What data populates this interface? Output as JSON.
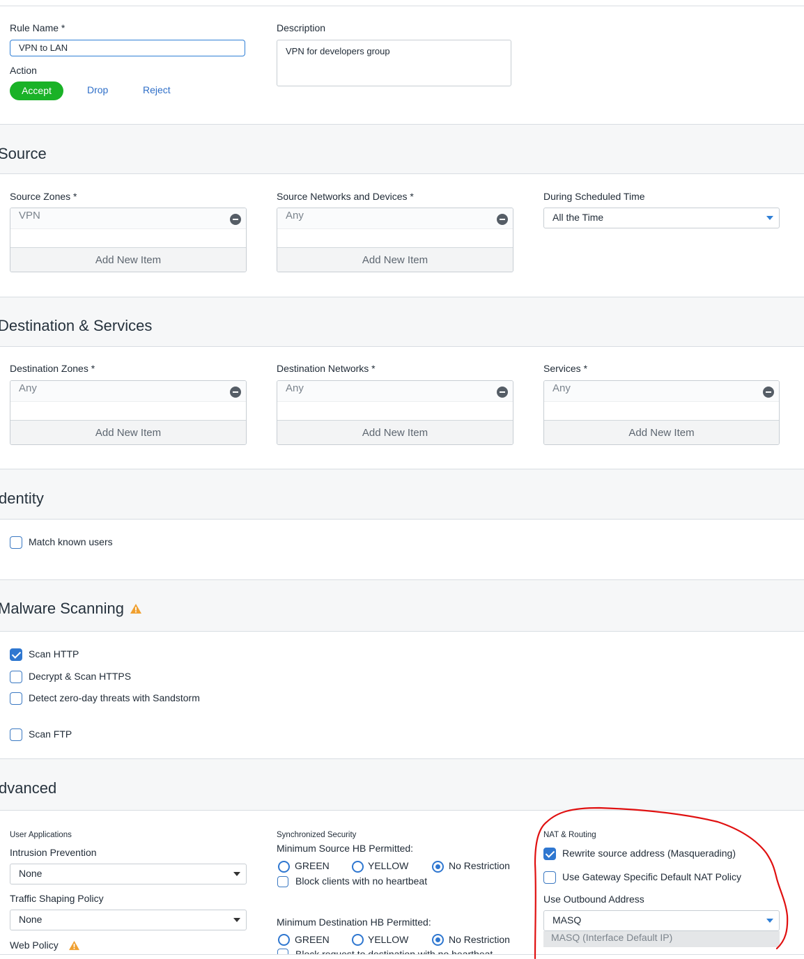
{
  "rule": {
    "name_label": "Rule Name *",
    "name_value": "VPN to LAN",
    "description_label": "Description",
    "description_value": "VPN for developers group",
    "action_label": "Action",
    "actions": [
      "Accept",
      "Drop",
      "Reject"
    ],
    "selected_action": "Accept"
  },
  "source": {
    "title": "Source",
    "zones_label": "Source Zones *",
    "zones_value": "VPN",
    "networks_label": "Source Networks and Devices *",
    "networks_value": "Any",
    "schedule_label": "During Scheduled Time",
    "schedule_value": "All the Time",
    "add_item": "Add New Item"
  },
  "destination": {
    "title": "Destination & Services",
    "zones_label": "Destination Zones *",
    "zones_value": "Any",
    "networks_label": "Destination Networks *",
    "networks_value": "Any",
    "services_label": "Services *",
    "services_value": "Any",
    "add_item": "Add New Item"
  },
  "identity": {
    "title": "dentity",
    "match_known_users": "Match known users",
    "match_known_users_checked": false
  },
  "malware": {
    "title": "Malware Scanning",
    "options": [
      {
        "label": "Scan HTTP",
        "checked": true
      },
      {
        "label": "Decrypt & Scan HTTPS",
        "checked": false
      },
      {
        "label": "Detect zero-day threats with Sandstorm",
        "checked": false
      },
      {
        "label": "Scan FTP",
        "checked": false
      }
    ]
  },
  "advanced": {
    "title": "dvanced",
    "user_apps_heading": "User Applications",
    "ips_label": "Intrusion Prevention",
    "ips_value": "None",
    "traffic_label": "Traffic Shaping Policy",
    "traffic_value": "None",
    "web_policy_label": "Web Policy",
    "sync_heading": "Synchronized Security",
    "min_source_label": "Minimum Source HB Permitted:",
    "min_dest_label": "Minimum Destination HB Permitted:",
    "hb_options": [
      "GREEN",
      "YELLOW",
      "No Restriction"
    ],
    "hb_selected": "No Restriction",
    "block_clients": "Block clients with no heartbeat",
    "block_request": "Block request to destination with no heartbeat",
    "nat_heading": "NAT & Routing",
    "rewrite_source": "Rewrite source address (Masquerading)",
    "rewrite_source_checked": true,
    "gateway_nat": "Use Gateway Specific Default NAT Policy",
    "gateway_nat_checked": false,
    "outbound_label": "Use Outbound Address",
    "outbound_value": "MASQ",
    "outbound_option": "MASQ (Interface Default IP)"
  },
  "colors": {
    "accept_green": "#1ab227",
    "link_blue": "#2f6fc8",
    "warning_orange": "#f0a030",
    "annotation_red": "#e01010"
  }
}
